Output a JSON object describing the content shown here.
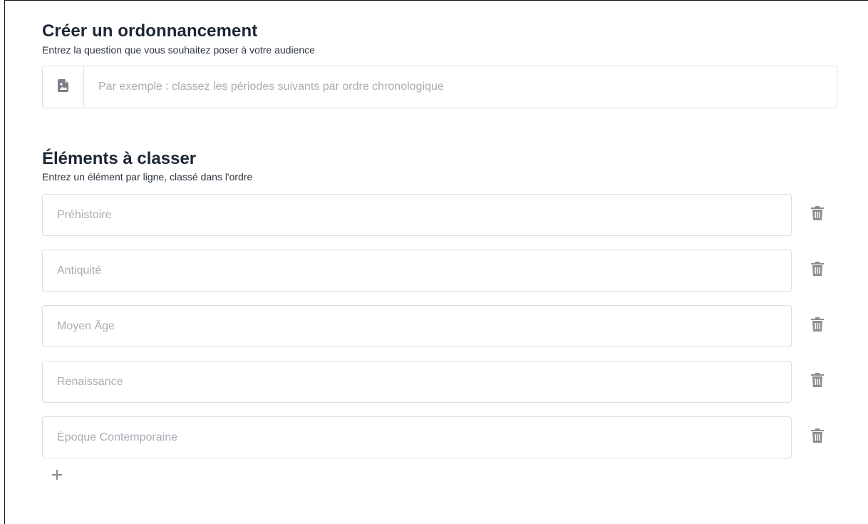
{
  "question_section": {
    "title": "Créer un ordonnancement",
    "subtitle": "Entrez la question que vous souhaitez poser à votre audience",
    "input_placeholder": "Par exemple : classez les périodes suivants par ordre chronologique",
    "input_value": "",
    "icon": "image-file-icon"
  },
  "items_section": {
    "title": "Éléments à classer",
    "subtitle": "Entrez un élément par ligne, classé dans l'ordre",
    "items": [
      {
        "placeholder": "Préhistoire",
        "value": ""
      },
      {
        "placeholder": "Antiquité",
        "value": ""
      },
      {
        "placeholder": "Moyen Âge",
        "value": ""
      },
      {
        "placeholder": "Renaissance",
        "value": ""
      },
      {
        "placeholder": "Époque Contemporaine",
        "value": ""
      }
    ],
    "delete_icon": "trash-icon",
    "add_icon": "plus-icon"
  },
  "colors": {
    "text": "#1d2733",
    "placeholder": "#a7adb4",
    "border": "#dcdfe3",
    "icon": "#7a7f86"
  }
}
